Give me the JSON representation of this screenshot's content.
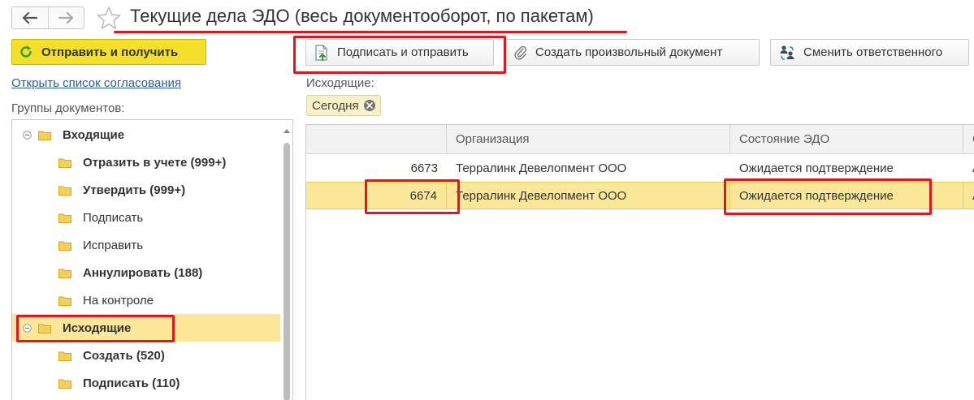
{
  "nav": {
    "back_icon": "arrow-left-icon",
    "forward_icon": "arrow-right-icon",
    "favorite_icon": "star-outline-icon"
  },
  "page_title": "Текущие дела ЭДО (весь документооборот, по пакетам)",
  "left_panel": {
    "send_receive_label": "Отправить и получить",
    "open_approval_link": "Открыть список согласования",
    "groups_label": "Группы документов:",
    "tree": [
      {
        "label": "Входящие",
        "bold": true,
        "level": 0,
        "expanded": true
      },
      {
        "label": "Отразить в учете (999+)",
        "bold": true,
        "level": 1
      },
      {
        "label": "Утвердить (999+)",
        "bold": true,
        "level": 1
      },
      {
        "label": "Подписать",
        "bold": false,
        "level": 1
      },
      {
        "label": "Исправить",
        "bold": false,
        "level": 1
      },
      {
        "label": "Аннулировать (188)",
        "bold": true,
        "level": 1
      },
      {
        "label": "На контроле",
        "bold": false,
        "level": 1
      },
      {
        "label": "Исходящие",
        "bold": true,
        "level": 0,
        "expanded": true,
        "selected": true
      },
      {
        "label": "Создать (520)",
        "bold": true,
        "level": 1
      },
      {
        "label": "Подписать (110)",
        "bold": true,
        "level": 1
      }
    ]
  },
  "toolbar": {
    "sign_send_label": "Подписать и отправить",
    "create_doc_label": "Создать произвольный документ",
    "change_responsible_label": "Сменить ответственного"
  },
  "filter": {
    "label": "Исходящие:",
    "chip_label": "Сегодня"
  },
  "table": {
    "columns": [
      "",
      "Организация",
      "Состояние ЭДО",
      "С"
    ],
    "rows": [
      {
        "number": "6673",
        "organization": "Терралинк Девелопмент ООО",
        "status": "Ожидается подтверждение",
        "extra": "А",
        "selected": false
      },
      {
        "number": "6674",
        "organization": "Терралинк Девелопмент ООО",
        "status": "Ожидается подтверждение",
        "extra": "А",
        "selected": true
      }
    ]
  },
  "colors": {
    "accent_yellow": "#f4e02b",
    "selection": "#fbe79a",
    "annotation_red": "#e8141c",
    "link": "#2a5d9f"
  }
}
